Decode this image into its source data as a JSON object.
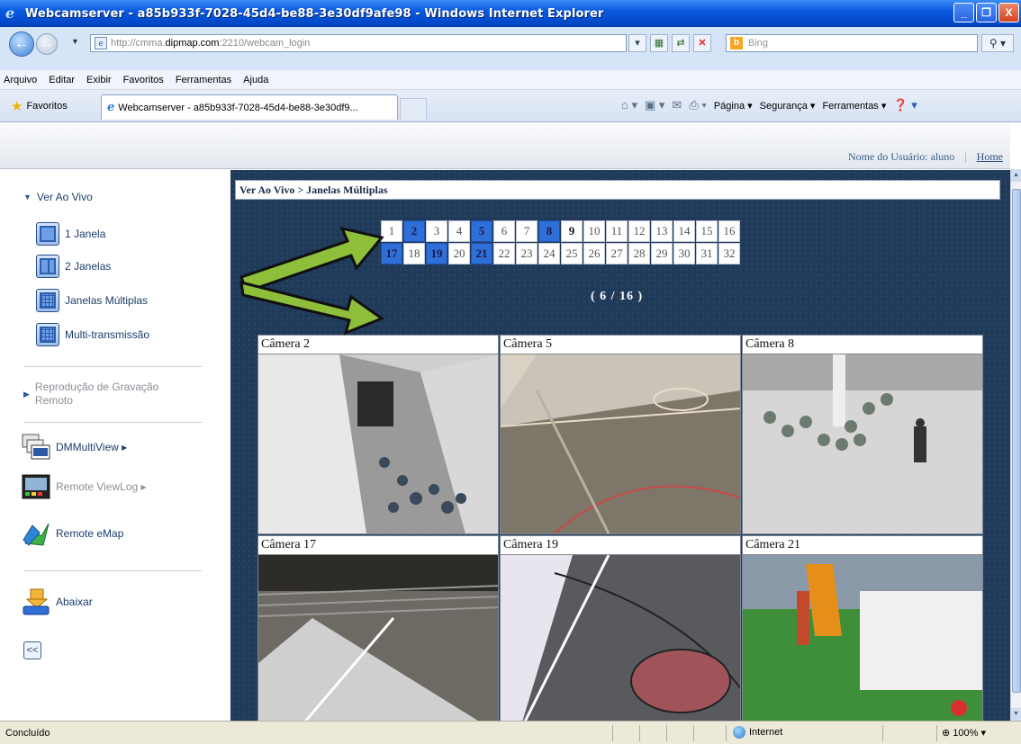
{
  "window": {
    "title": "Webcamserver - a85b933f-7028-45d4-be88-3e30df9afe98 - Windows Internet Explorer",
    "minimize": "_",
    "maximize": "❐",
    "close": "X"
  },
  "address": {
    "url_prefix": "http://cmma.",
    "url_domain": "dipmap.com",
    "url_suffix": ":2210/webcam_login",
    "search_placeholder": "Bing"
  },
  "menu": [
    "Arquivo",
    "Editar",
    "Exibir",
    "Favoritos",
    "Ferramentas",
    "Ajuda"
  ],
  "favorites_label": "Favoritos",
  "tab_title": "Webcamserver - a85b933f-7028-45d4-be88-3e30df9...",
  "command_bar": {
    "page": "Página ▾",
    "security": "Segurança ▾",
    "tools": "Ferramentas ▾"
  },
  "header": {
    "user": "Nome do Usuário: aluno",
    "separator": "|",
    "home": "Home"
  },
  "sidebar": {
    "live": "Ver Ao Vivo",
    "items": [
      "1 Janela",
      "2 Janelas",
      "Janelas Múltiplas",
      "Multi-transmissão"
    ],
    "playback": "Reprodução de Gravação Remoto",
    "multiview": "DMMultiView ▸",
    "viewlog": "Remote ViewLog ▸",
    "emap": "Remote eMap",
    "download": "Abaixar",
    "collapse": "<<"
  },
  "main": {
    "breadcrumb": "Ver Ao Vivo > Janelas Múltiplas",
    "pager_row1": [
      "1",
      "2",
      "3",
      "4",
      "5",
      "6",
      "7",
      "8",
      "9",
      "10",
      "11",
      "12",
      "13",
      "14",
      "15",
      "16"
    ],
    "pager_row2": [
      "17",
      "18",
      "19",
      "20",
      "21",
      "22",
      "23",
      "24",
      "25",
      "26",
      "27",
      "28",
      "29",
      "30",
      "31",
      "32"
    ],
    "active_cameras": [
      "2",
      "5",
      "8",
      "17",
      "19",
      "21"
    ],
    "bold_numbers": [
      "9"
    ],
    "page_count": "( 6 / 16 )",
    "cameras": [
      "Câmera 2",
      "Câmera 5",
      "Câmera 8",
      "Câmera 17",
      "Câmera 19",
      "Câmera 21"
    ]
  },
  "status": {
    "text": "Concluído",
    "zone": "Internet",
    "zoom": "100%"
  }
}
